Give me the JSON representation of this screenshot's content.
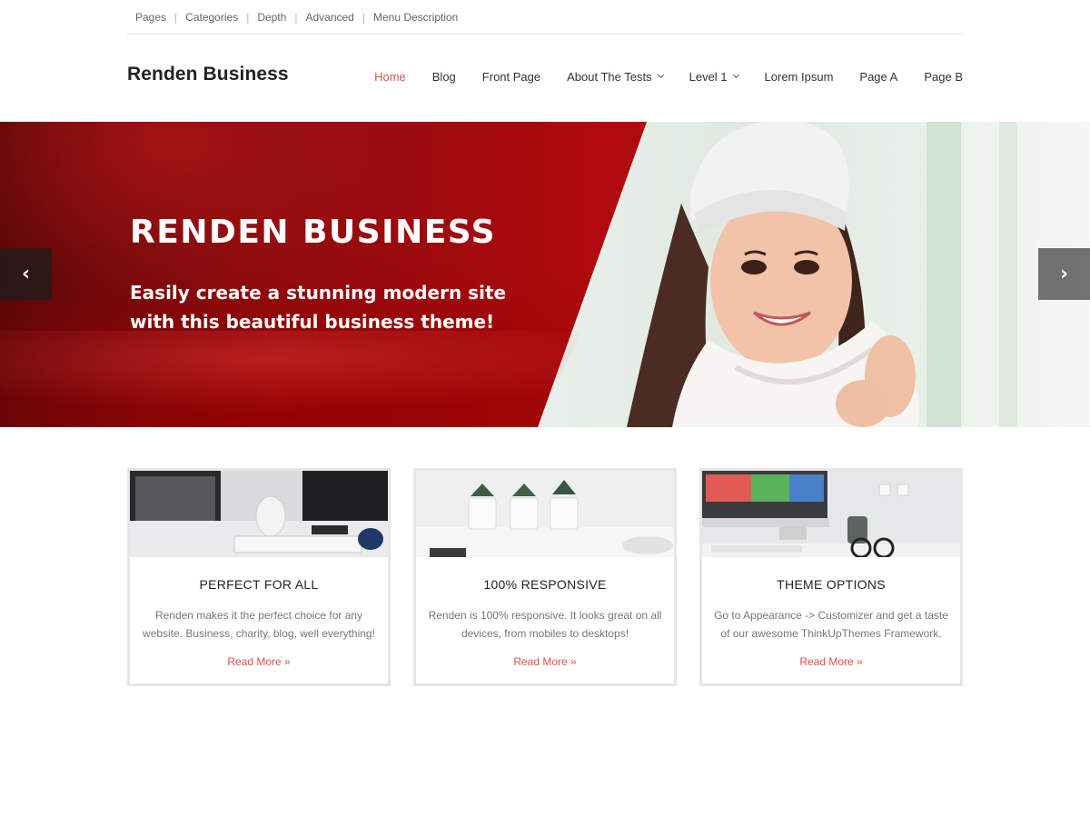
{
  "topbar": {
    "items": [
      "Pages",
      "Categories",
      "Depth",
      "Advanced",
      "Menu Description"
    ]
  },
  "header": {
    "site_title": "Renden Business",
    "nav": [
      {
        "label": "Home",
        "active": true
      },
      {
        "label": "Blog"
      },
      {
        "label": "Front Page"
      },
      {
        "label": "About The Tests",
        "dropdown": true
      },
      {
        "label": "Level 1",
        "dropdown": true
      },
      {
        "label": "Lorem Ipsum"
      },
      {
        "label": "Page A"
      },
      {
        "label": "Page B"
      }
    ]
  },
  "slider": {
    "title": "RENDEN BUSINESS",
    "subtitle_line1": "Easily create a stunning modern site",
    "subtitle_line2": "with this beautiful business theme!",
    "prev_glyph": "‹",
    "next_glyph": "›"
  },
  "features": [
    {
      "title": "PERFECT FOR ALL",
      "line1": "Renden makes it the perfect choice for any",
      "line2": "website. Business, charity, blog, well everything!",
      "more": "Read More »"
    },
    {
      "title": "100% RESPONSIVE",
      "line1": "Renden is 100% responsive. It looks great on all",
      "line2": "devices, from mobiles to desktops!",
      "more": "Read More »"
    },
    {
      "title": "THEME OPTIONS",
      "line1": "Go to Appearance -> Customizer and get a taste",
      "line2": "of our awesome ThinkUpThemes Framework.",
      "more": "Read More »"
    }
  ],
  "colors": {
    "accent": "#d9534f",
    "hero_red": "#b00a0e"
  }
}
